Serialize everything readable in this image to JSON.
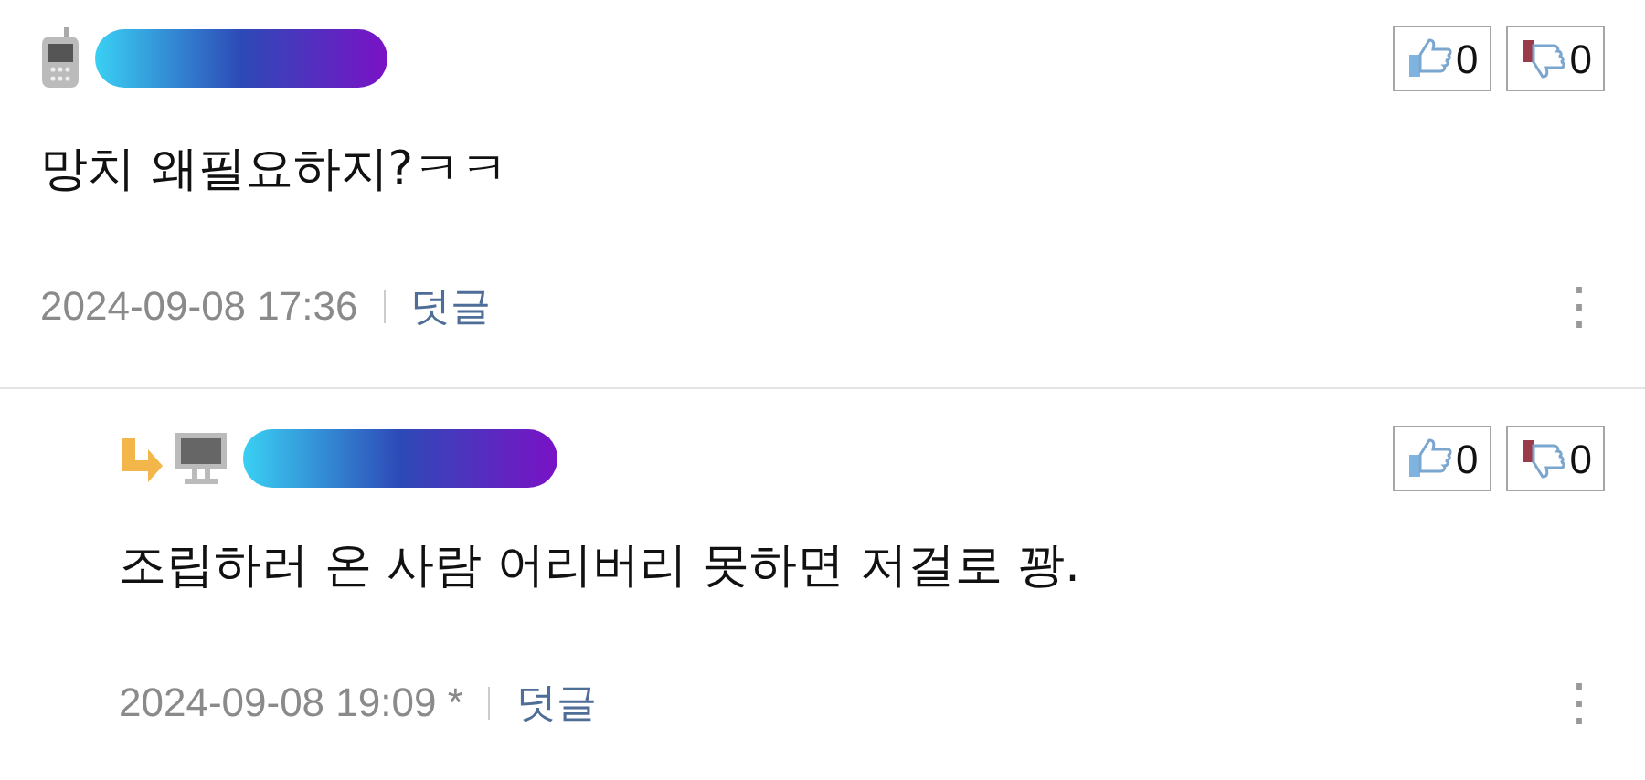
{
  "comments": [
    {
      "kind": "mobile",
      "reply": false,
      "likes": "0",
      "dislikes": "0",
      "text": "망치 왜필요하지?ㅋㅋ",
      "date": "2024-09-08 17:36",
      "reply_link": "덧글",
      "more": "⋮"
    },
    {
      "kind": "pc",
      "reply": true,
      "likes": "0",
      "dislikes": "0",
      "text": "조립하러 온 사람 어리버리 못하면 저걸로 꽝.",
      "date": "2024-09-08 19:09",
      "edited_mark": "*",
      "reply_link": "덧글",
      "more": "⋮"
    }
  ]
}
